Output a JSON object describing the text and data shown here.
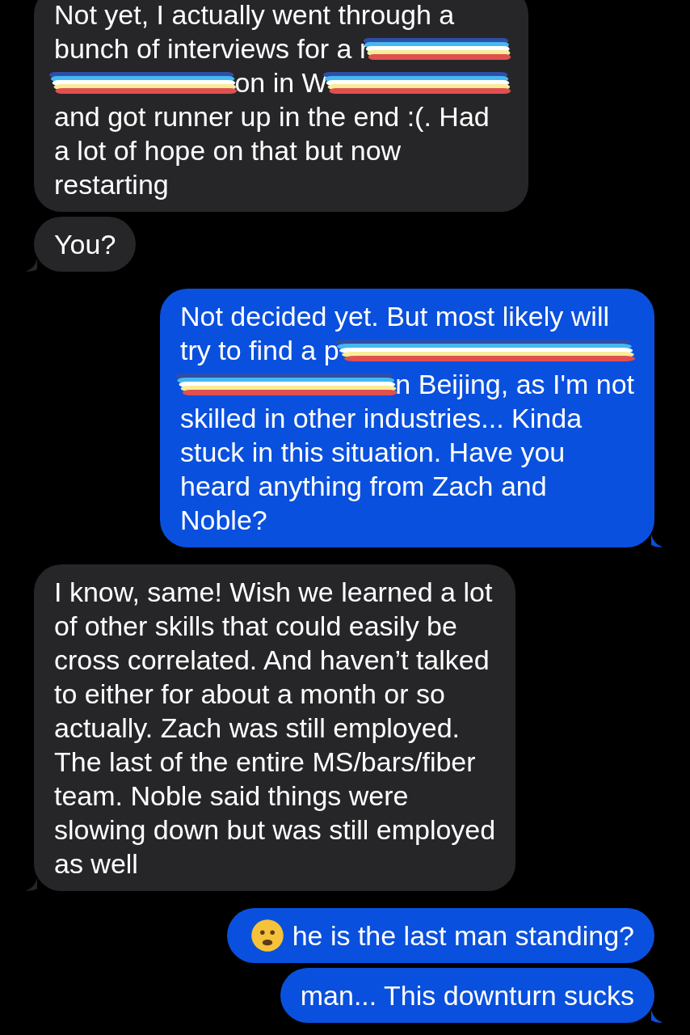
{
  "messages": [
    {
      "sent": false,
      "tail": false,
      "lines": [
        [
          {
            "kind": "text",
            "text": "Not yet, I actually went through a"
          }
        ],
        [
          {
            "kind": "text",
            "text": "bunch of interviews for a r"
          },
          {
            "kind": "redaction"
          }
        ],
        [
          {
            "kind": "redaction"
          },
          {
            "kind": "text",
            "text": "on in W"
          },
          {
            "kind": "redaction"
          }
        ],
        [
          {
            "kind": "text",
            "text": "and got runner up in the end :(. Had"
          }
        ],
        [
          {
            "kind": "text",
            "text": "a lot of hope on that but now"
          }
        ],
        [
          {
            "kind": "text",
            "text": "restarting"
          }
        ]
      ]
    },
    {
      "sent": false,
      "tail": true,
      "lines": [
        [
          {
            "kind": "text",
            "text": "You?"
          }
        ]
      ]
    },
    {
      "sent": true,
      "tail": true,
      "lines": [
        [
          {
            "kind": "text",
            "text": "Not decided yet. But most likely will"
          }
        ],
        [
          {
            "kind": "text",
            "text": "try to find a p"
          },
          {
            "kind": "redaction"
          }
        ],
        [
          {
            "kind": "redaction"
          },
          {
            "kind": "text",
            "text": "n Beijing, as I'm not"
          }
        ],
        [
          {
            "kind": "text",
            "text": "skilled in other industries... Kinda"
          }
        ],
        [
          {
            "kind": "text",
            "text": "stuck in this situation. Have you"
          }
        ],
        [
          {
            "kind": "text",
            "text": "heard anything from Zach and"
          }
        ],
        [
          {
            "kind": "text",
            "text": "Noble?"
          }
        ]
      ]
    },
    {
      "sent": false,
      "tail": true,
      "lines": [
        [
          {
            "kind": "text",
            "text": "I know, same! Wish we learned a lot"
          }
        ],
        [
          {
            "kind": "text",
            "text": "of other skills that could easily be"
          }
        ],
        [
          {
            "kind": "text",
            "text": "cross correlated. And haven’t talked"
          }
        ],
        [
          {
            "kind": "text",
            "text": "to either for about a month or so"
          }
        ],
        [
          {
            "kind": "text",
            "text": "actually. Zach was still employed."
          }
        ],
        [
          {
            "kind": "text",
            "text": "The last of the entire MS/bars/fiber"
          }
        ],
        [
          {
            "kind": "text",
            "text": "team. Noble said things were"
          }
        ],
        [
          {
            "kind": "text",
            "text": "slowing down but was still employed"
          }
        ],
        [
          {
            "kind": "text",
            "text": "as well"
          }
        ]
      ]
    },
    {
      "sent": true,
      "tail": false,
      "lines": [
        [
          {
            "kind": "emoji"
          },
          {
            "kind": "text",
            "text": "he is the last man standing?"
          }
        ]
      ]
    },
    {
      "sent": true,
      "tail": true,
      "lines": [
        [
          {
            "kind": "text",
            "text": "man... This downturn sucks"
          }
        ]
      ]
    }
  ]
}
